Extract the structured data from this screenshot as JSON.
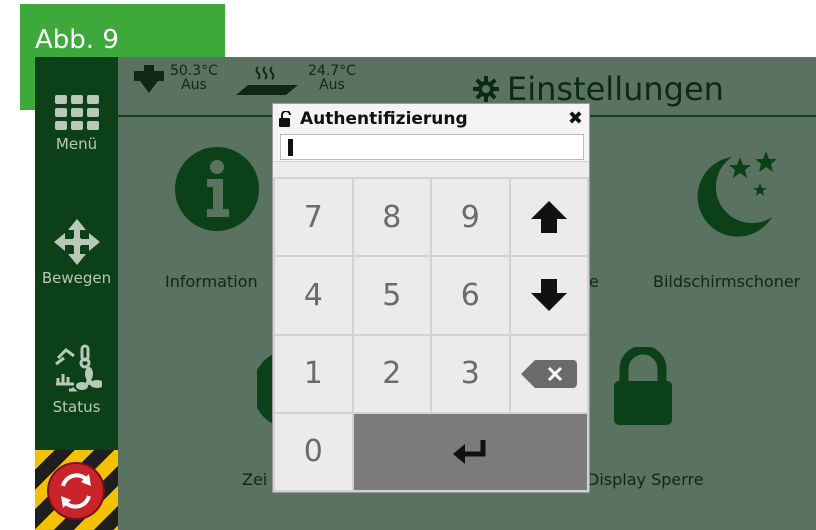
{
  "badge": {
    "label": "Abb. 9"
  },
  "sidebar": {
    "items": [
      {
        "label": "Menü",
        "icon": "grid-menu-icon"
      },
      {
        "label": "Bewegen",
        "icon": "move-arrows-icon"
      },
      {
        "label": "Status",
        "icon": "status-icon"
      }
    ],
    "estop_icon": "emergency-stop-icon"
  },
  "header": {
    "temp1": {
      "value": "50.3°C",
      "state": "Aus",
      "icon": "heater-icon"
    },
    "temp2": {
      "value": "24.7°C",
      "state": "Aus",
      "icon": "heat-bed-icon"
    },
    "title": "Einstellungen",
    "title_icon": "gear-icon"
  },
  "tiles": {
    "information": {
      "label": "Information",
      "icon": "info-icon"
    },
    "partial_e": {
      "label": "e"
    },
    "screensaver": {
      "label": "Bildschirmschoner",
      "icon": "moon-stars-icon"
    },
    "zeit": {
      "label": "Zei"
    },
    "display_lock": {
      "label": "Display Sperre",
      "icon": "lock-icon"
    }
  },
  "dialog": {
    "title": "Authentifizierung",
    "title_icon": "unlock-icon",
    "close_icon": "close-icon",
    "input_value": "",
    "keys": [
      "7",
      "8",
      "9",
      "4",
      "5",
      "6",
      "1",
      "2",
      "3",
      "0"
    ],
    "colors": {
      "accent": "#0c4019",
      "screen": "#5a7361",
      "badge": "#3ea93b"
    }
  }
}
